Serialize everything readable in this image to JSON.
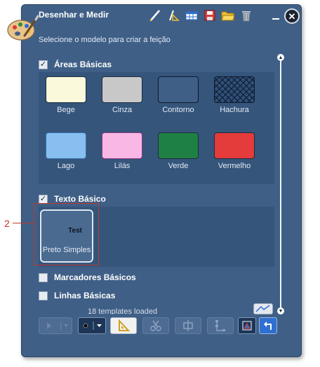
{
  "window": {
    "title": "Desenhar e Medir",
    "instruction": "Selecione o modelo para criar a feição",
    "close_glyph": "✕"
  },
  "sections": [
    {
      "label": "Áreas Básicas",
      "checked": true,
      "templates": [
        {
          "label": "Bege",
          "color": "#fbf9dc"
        },
        {
          "label": "Cinza",
          "color": "#c8c8c8"
        },
        {
          "label": "Contorno",
          "color": "#3f5f86"
        },
        {
          "label": "Hachura",
          "color": "#2f4f7a"
        },
        {
          "label": "Lago",
          "color": "#86bff0"
        },
        {
          "label": "Lilás",
          "color": "#f9b7e6"
        },
        {
          "label": "Verde",
          "color": "#1f8043"
        },
        {
          "label": "Vermelho",
          "color": "#e43b3b"
        }
      ]
    },
    {
      "label": "Texto Básico",
      "checked": true,
      "templates": [
        {
          "label": "Preto Simples",
          "sample": "Test"
        }
      ]
    },
    {
      "label": "Marcadores Básicos",
      "checked": false
    },
    {
      "label": "Linhas Básicas",
      "checked": false
    }
  ],
  "status": "18 templates loaded",
  "annotation": {
    "number": "2",
    "color": "#c0392b"
  },
  "colors": {
    "panel": "#3f5f86",
    "group_bg": "#35557b",
    "text": "#ffffff"
  }
}
